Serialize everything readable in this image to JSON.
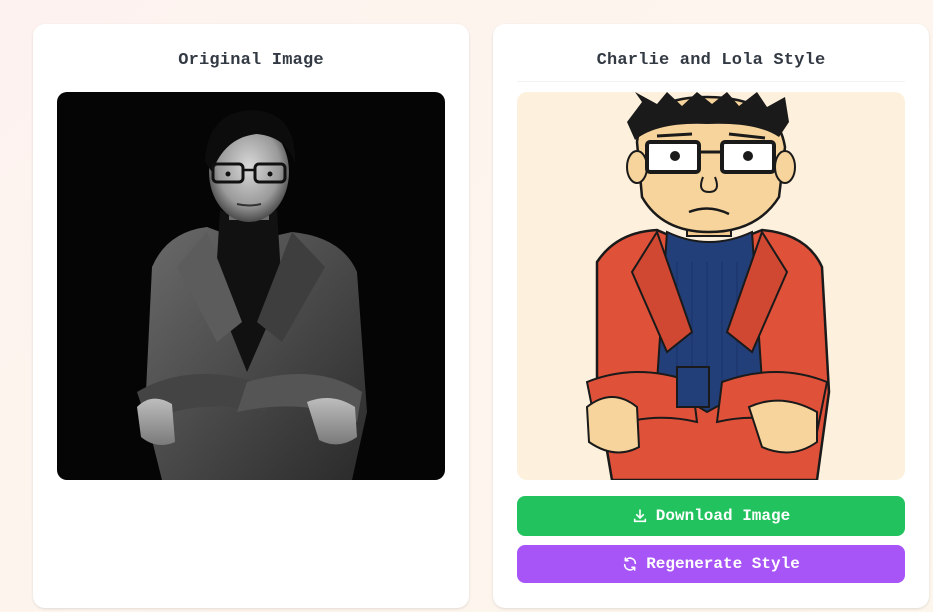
{
  "original_card": {
    "title": "Original Image"
  },
  "styled_card": {
    "title": "Charlie and Lola Style",
    "download_label": "Download Image",
    "regenerate_label": "Regenerate Style"
  },
  "icons": {
    "download": "download-icon",
    "regenerate": "refresh-icon"
  },
  "colors": {
    "download_button": "#22c35e",
    "regenerate_button": "#a855f7",
    "title_text": "#333a44"
  }
}
